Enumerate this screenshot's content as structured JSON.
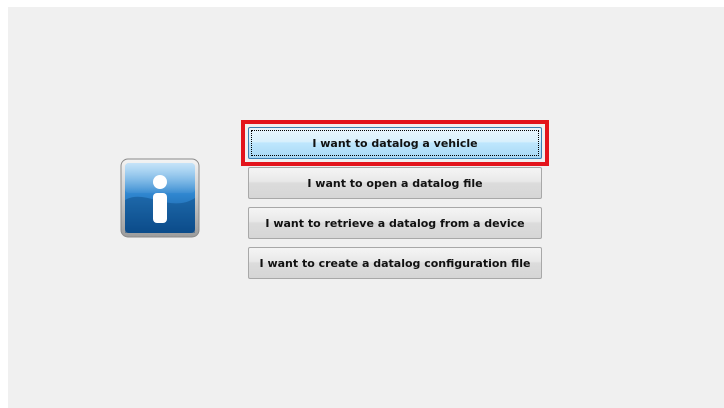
{
  "options": [
    {
      "label": "I want to datalog a vehicle"
    },
    {
      "label": "I want to open a datalog file"
    },
    {
      "label": "I want to retrieve a datalog from a device"
    },
    {
      "label": "I want to create a datalog configuration file"
    }
  ],
  "icon": {
    "name": "info-icon",
    "color": "#1b6bb3"
  },
  "highlight_color": "#e3141c"
}
